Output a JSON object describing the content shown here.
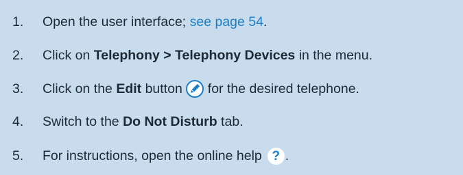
{
  "steps": [
    {
      "num": "1.",
      "text_before": "Open the user interface; ",
      "link": "see page 54",
      "text_after": "."
    },
    {
      "num": "2.",
      "text_before": "Click on ",
      "bold": "Telephony > Telephony Devices",
      "text_after": " in the menu."
    },
    {
      "num": "3.",
      "text_before": "Click on the ",
      "bold": "Edit",
      "text_mid": " button",
      "icon": "edit-pencil-icon",
      "text_after": "for the desired telephone."
    },
    {
      "num": "4.",
      "text_before": "Switch to the ",
      "bold": "Do Not Disturb",
      "text_after": " tab."
    },
    {
      "num": "5.",
      "text_before": "For instructions, open the online help",
      "icon": "help-icon",
      "icon_glyph": "?",
      "text_after": "."
    }
  ],
  "colors": {
    "background": "#c9dcee",
    "text": "#1d2a35",
    "link": "#1a7fc4",
    "icon_blue": "#1c7fc6",
    "icon_fill": "#ffffff"
  }
}
